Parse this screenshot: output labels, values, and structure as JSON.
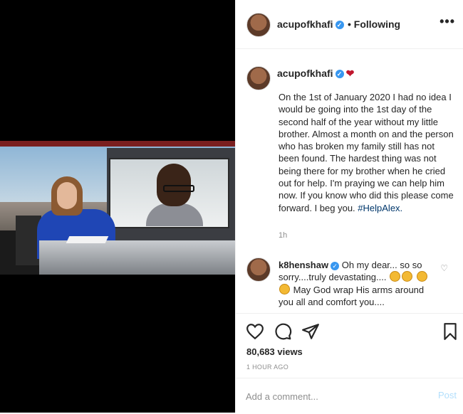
{
  "header": {
    "username": "acupofkhafi",
    "following_label": "• Following",
    "more_label": "•••"
  },
  "caption": {
    "username": "acupofkhafi",
    "text": "On the 1st of January 2020 I had no idea I would be going into the 1st day of the second half of the year without my little brother. Almost a month on and the person who has broken my family still has not been found. The hardest thing was not being there for my brother when he cried out for help. I'm praying we can help him now. If you know who did this please come forward. I beg you.",
    "hashtag": "#HelpAlex.",
    "time": "1h"
  },
  "comment": {
    "username": "k8henshaw",
    "text_1": "Oh my dear... so so sorry....truly devastating....",
    "text_2": "May God wrap His arms around you all and comfort you...."
  },
  "stats": {
    "views": "80,683 views",
    "posted": "1 HOUR AGO"
  },
  "add_comment": {
    "placeholder": "Add a comment...",
    "post_label": "Post"
  },
  "icons": [
    "heart-icon",
    "comment-icon",
    "share-icon",
    "bookmark-icon",
    "verified-icon",
    "more-icon"
  ]
}
